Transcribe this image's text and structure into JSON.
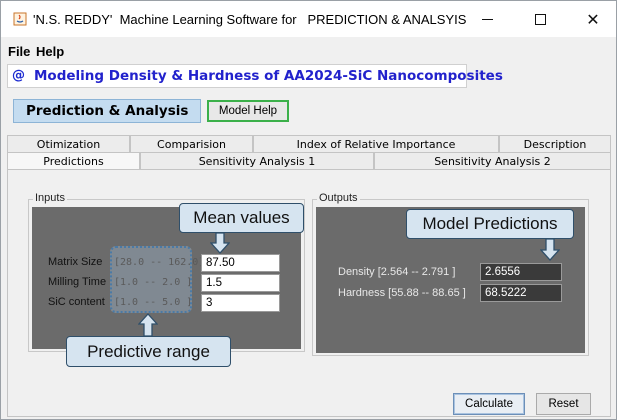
{
  "window": {
    "title": "'N.S. REDDY'  Machine Learning Software for   PREDICTION & ANALSYIS",
    "minimize_glyph": "",
    "maximize_glyph": "",
    "close_glyph": "✕"
  },
  "menu": {
    "file": "File",
    "help": "Help"
  },
  "app": {
    "icon": "@",
    "title": "Modeling Density & Hardness of AA2024-SiC Nanocomposites"
  },
  "header": {
    "section_label": "Prediction & Analysis",
    "model_help_label": "Model Help"
  },
  "tabs": {
    "row1": [
      "Otimization",
      "Comparision",
      "Index of Relative Importance",
      "Description"
    ],
    "row2": [
      "Predictions",
      "Sensitivity Analysis 1",
      "Sensitivity Analysis 2"
    ],
    "selected": "Predictions"
  },
  "inputs": {
    "legend": "Inputs",
    "rows": [
      {
        "label": "Matrix Size",
        "range": "[28.0 -- 162.0]",
        "value": "87.50"
      },
      {
        "label": "Milling Time",
        "range": "[1.0 -- 2.0 ]",
        "value": "1.5"
      },
      {
        "label": "SiC content",
        "range": "[1.0 -- 5.0 ]",
        "value": "3"
      }
    ]
  },
  "outputs": {
    "legend": "Outputs",
    "rows": [
      {
        "label": "Density [2.564 -- 2.791 ]",
        "value": "2.6556"
      },
      {
        "label": "Hardness [55.88 -- 88.65 ]",
        "value": "68.5222"
      }
    ]
  },
  "annotations": {
    "mean_values": "Mean values",
    "model_predictions": "Model Predictions",
    "predictive_range": "Predictive range"
  },
  "buttons": {
    "calculate": "Calculate",
    "reset": "Reset"
  },
  "colors": {
    "title_blue": "#2222cc",
    "callout_bg": "#d6e4f0",
    "dark_panel": "#6b6b6b",
    "model_help_border": "#3bb04a"
  }
}
